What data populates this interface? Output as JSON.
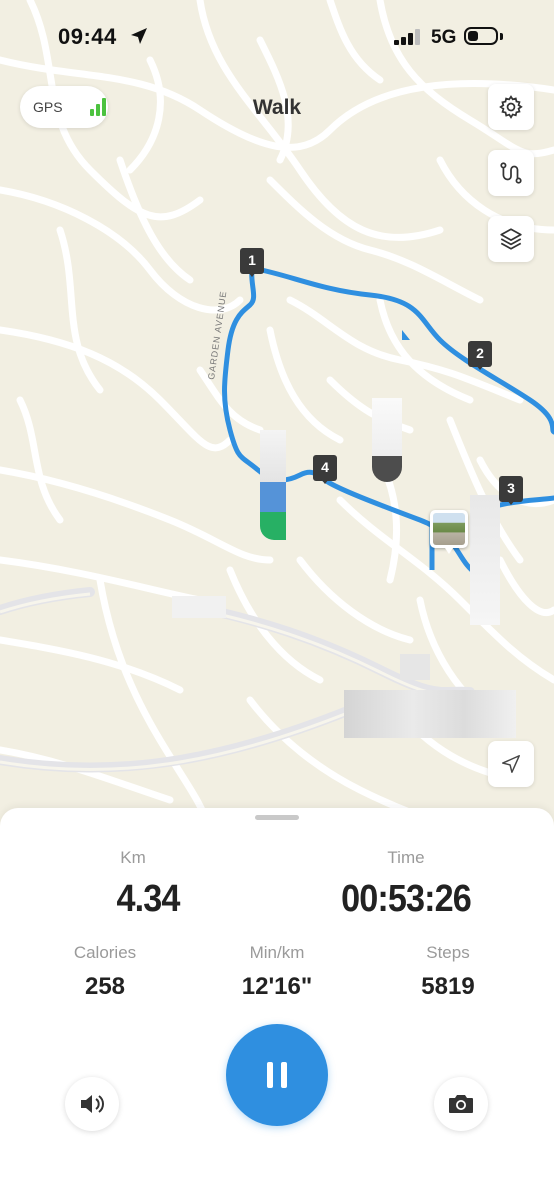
{
  "status_bar": {
    "time": "09:44",
    "network": "5G"
  },
  "header": {
    "title": "Walk",
    "gps_label": "GPS"
  },
  "map": {
    "street_label": "GARDEN AVENUE",
    "route_color": "#2f8fe0",
    "markers": [
      "1",
      "2",
      "3",
      "4"
    ],
    "buttons": [
      "gear-icon",
      "route-icon",
      "layers-icon",
      "navigation-arrow-icon"
    ]
  },
  "stats": {
    "distance": {
      "label": "Km",
      "value": "4.34"
    },
    "duration": {
      "label": "Time",
      "value": "00:53:26"
    },
    "calories": {
      "label": "Calories",
      "value": "258"
    },
    "pace": {
      "label": "Min/km",
      "value": "12'16\""
    },
    "steps": {
      "label": "Steps",
      "value": "5819"
    }
  },
  "controls": {
    "accent_color": "#2f8fe0",
    "icons": [
      "speaker-icon",
      "pause-icon",
      "camera-icon"
    ]
  }
}
